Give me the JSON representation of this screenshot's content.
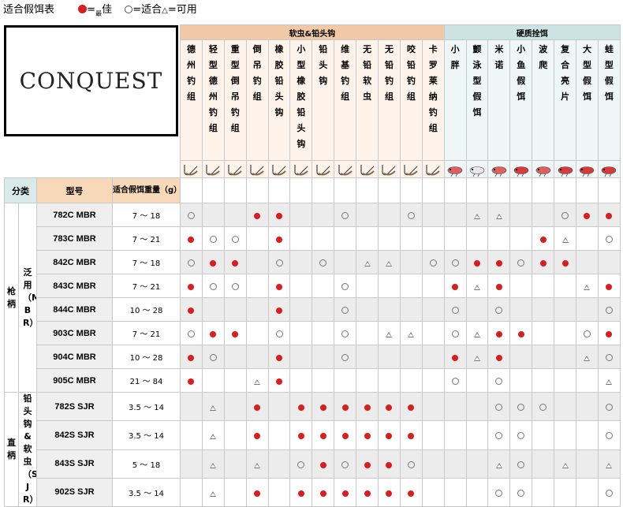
{
  "legend": {
    "title": "适合假饵表",
    "best_prefix": "=",
    "best_sub": "最",
    "best_label": "佳",
    "suitable": "=适合",
    "usable": "=可用"
  },
  "logo_text": "CONQUEST",
  "groups": {
    "soft": "软虫&铅头钩",
    "hard": "硬质拴饵"
  },
  "lures": [
    {
      "name": "德州钓组",
      "group": "soft",
      "icon": "texas-rig-icon"
    },
    {
      "name": "轻型德州钓组",
      "group": "soft",
      "icon": "light-texas-rig-icon"
    },
    {
      "name": "重型倒吊钓组",
      "group": "soft",
      "icon": "heavy-drop-shot-icon"
    },
    {
      "name": "倒吊钓组",
      "group": "soft",
      "icon": "drop-shot-icon"
    },
    {
      "name": "橡胶铅头钩",
      "group": "soft",
      "icon": "rubber-jig-icon"
    },
    {
      "name": "小型橡胶铅头钩",
      "group": "soft",
      "icon": "small-rubber-jig-icon"
    },
    {
      "name": "铅头钩",
      "group": "soft",
      "icon": "jighead-icon"
    },
    {
      "name": "维基钓组",
      "group": "soft",
      "icon": "wacky-rig-icon"
    },
    {
      "name": "无铅软虫",
      "group": "soft",
      "icon": "weightless-worm-icon"
    },
    {
      "name": "无铅钓组",
      "group": "soft",
      "icon": "weightless-rig-icon"
    },
    {
      "name": "咬铅钓组",
      "group": "soft",
      "icon": "split-shot-icon"
    },
    {
      "name": "卡罗莱纳钓组",
      "group": "soft",
      "icon": "carolina-rig-icon"
    },
    {
      "name": "小胖",
      "group": "hard",
      "icon": "crankbait-icon"
    },
    {
      "name": "颤泳型假饵",
      "group": "hard",
      "icon": "vibration-lure-icon"
    },
    {
      "name": "米诺",
      "group": "hard",
      "icon": "minnow-icon"
    },
    {
      "name": "小鱼假饵",
      "group": "hard",
      "icon": "small-fish-lure-icon"
    },
    {
      "name": "波爬",
      "group": "hard",
      "icon": "popper-icon"
    },
    {
      "name": "复合亮片",
      "group": "hard",
      "icon": "spinnerbait-icon"
    },
    {
      "name": "大型假饵",
      "group": "hard",
      "icon": "big-bait-icon"
    },
    {
      "name": "蛙型假饵",
      "group": "hard",
      "icon": "frog-lure-icon"
    }
  ],
  "headers": {
    "category": "分类",
    "model": "型号",
    "weight": "适合假饵重量（g）"
  },
  "categories": {
    "cast": "枪柄",
    "cast_sub": "泛用（MBR）",
    "spin": "直柄",
    "spin_sub": "铅头钩&软虫（SJR）"
  },
  "rows": [
    {
      "model": "782C MBR",
      "weight": "7 ～ 18",
      "marks": "o  **  o  o  ^^  o**** "
    },
    {
      "model": "783C MBR",
      "weight": "7 ～ 21",
      "marks": "*oo *           *^ o*^^"
    },
    {
      "model": "842C MBR",
      "weight": "7 ～ 18",
      "marks": "o** o o ^^ oo**o** "
    },
    {
      "model": "843C MBR",
      "weight": "7 ～ 21",
      "marks": "*oo *  o    *^*   ^*oo"
    },
    {
      "model": "844C MBR",
      "weight": "10 ～ 28",
      "marks": "*   *  o    o o    o**"
    },
    {
      "model": "903C MBR",
      "weight": "7 ～ 21",
      "marks": "o** o  o ^^ o^**  o*o "
    },
    {
      "model": "904C MBR",
      "weight": "10 ～ 28",
      "marks": "*o  *  o    *^*   ^o*^"
    },
    {
      "model": "905C MBR",
      "weight": "21 ～ 84",
      "marks": "*  ^*       o o    ^* "
    },
    {
      "model": "782S SJR",
      "weight": "3.5 ～ 14",
      "marks": " ^ * ******   ooo  o  "
    },
    {
      "model": "842S SJR",
      "weight": "3.5 ～ 14",
      "marks": " ^ * ******   oo   o *"
    },
    {
      "model": "843S SJR",
      "weight": "5 ～ 18",
      "marks": " ^ ^ o*o**o   ^o ^ ^ *"
    },
    {
      "model": "902S SJR",
      "weight": "3.5 ～ 14",
      "marks": " ^ * ******   oo   o o"
    }
  ]
}
